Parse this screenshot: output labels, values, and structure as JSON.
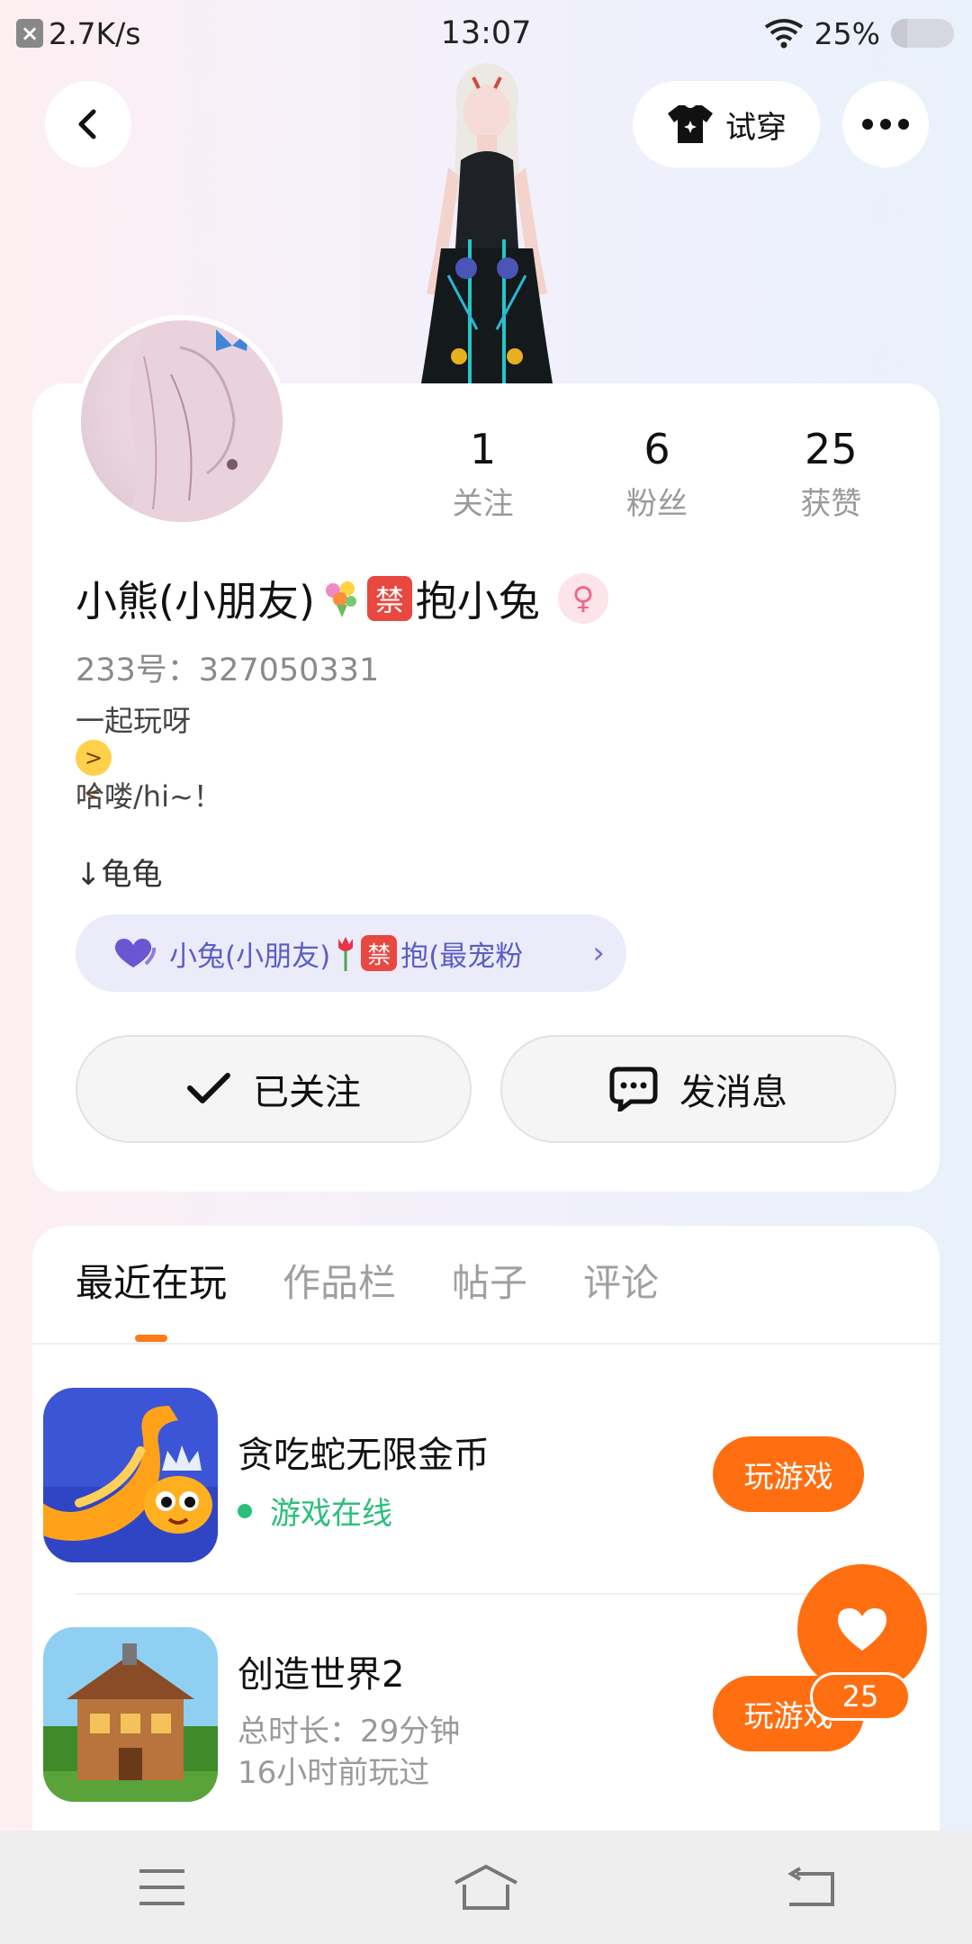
{
  "status_bar": {
    "speed": "2.7K/s",
    "time": "13:07",
    "battery": "25%",
    "battery_fraction": 0.25
  },
  "header": {
    "try_on_label": "试穿",
    "back_icon": "back-arrow-icon",
    "more_icon": "more-dots-icon"
  },
  "profile": {
    "stats": [
      {
        "value": "1",
        "label": "关注"
      },
      {
        "value": "6",
        "label": "粉丝"
      },
      {
        "value": "25",
        "label": "获赞"
      }
    ],
    "nickname_a": "小熊(小朋友)",
    "nickname_b": "抱小兔",
    "forbidden_char": "禁",
    "gender_symbol": "♀",
    "uid": "233号：327050331",
    "bio": [
      "一起玩呀",
      "哈喽/hi~！"
    ],
    "follow_tag": "↓龟龟",
    "fan_pill": {
      "text_a": "小兔(小朋友)",
      "forbidden_char": "禁",
      "text_b": "抱(最宠粉",
      "chevron": "›"
    },
    "follow_button": "已关注",
    "message_button": "发消息"
  },
  "tabs": [
    {
      "label": "最近在玩",
      "active": true
    },
    {
      "label": "作品栏",
      "active": false
    },
    {
      "label": "帖子",
      "active": false
    },
    {
      "label": "评论",
      "active": false
    }
  ],
  "games": [
    {
      "title": "贪吃蛇无限金币",
      "status": "游戏在线",
      "button": "玩游戏"
    },
    {
      "title": "创造世界2",
      "duration": "总时长：29分钟",
      "last_played": "16小时前玩过",
      "button": "玩游戏"
    }
  ],
  "like": {
    "count": "25"
  },
  "colors": {
    "accent": "#ff6f12",
    "online": "#2bbf7c",
    "fan_pill_text": "#5a5ec6"
  }
}
